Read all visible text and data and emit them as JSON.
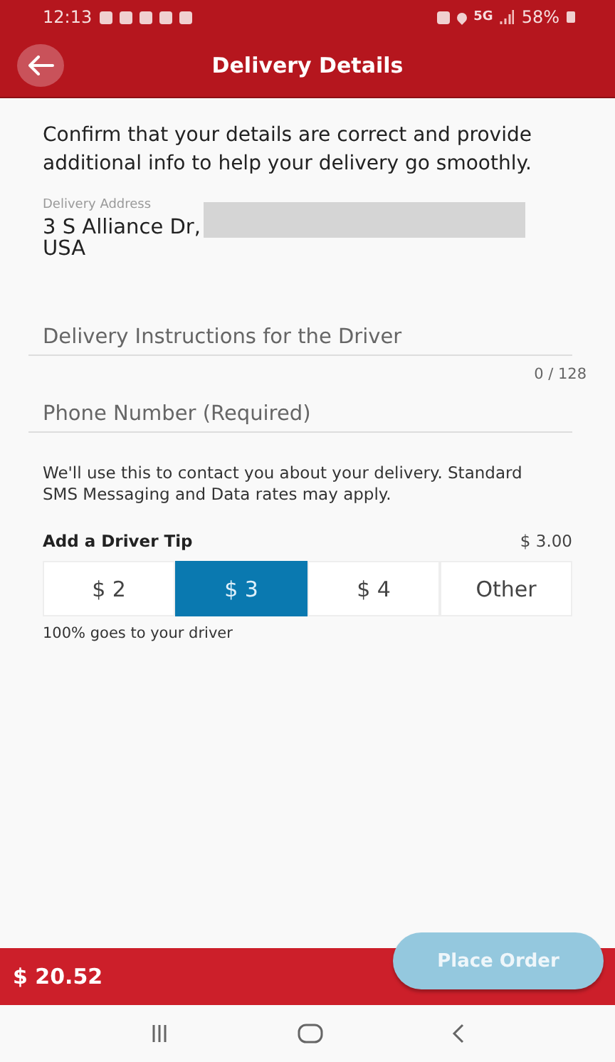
{
  "status_bar": {
    "time": "12:13",
    "network": "5G",
    "battery": "58%"
  },
  "header": {
    "title": "Delivery Details"
  },
  "intro": "Confirm that your details are correct and provide additional info to help your delivery go smoothly.",
  "address": {
    "label": "Delivery Address",
    "lines": [
      "3 S Alliance Dr,",
      "USA"
    ],
    "redacted": true
  },
  "instructions": {
    "placeholder": "Delivery Instructions for the Driver",
    "counter": "0 / 128"
  },
  "phone": {
    "placeholder": "Phone Number (Required)"
  },
  "phone_note": "We'll use this to contact you about your delivery. Standard SMS Messaging and Data rates may apply.",
  "tip": {
    "title": "Add a Driver Tip",
    "amount": "$ 3.00",
    "options": [
      {
        "label": "$ 2",
        "selected": false
      },
      {
        "label": "$ 3",
        "selected": true
      },
      {
        "label": "$ 4",
        "selected": false
      },
      {
        "label": "Other",
        "selected": false
      }
    ],
    "note": "100% goes to your driver"
  },
  "footer": {
    "total": "$ 20.52",
    "button": {
      "label": "Place Order",
      "disabled": true
    }
  }
}
